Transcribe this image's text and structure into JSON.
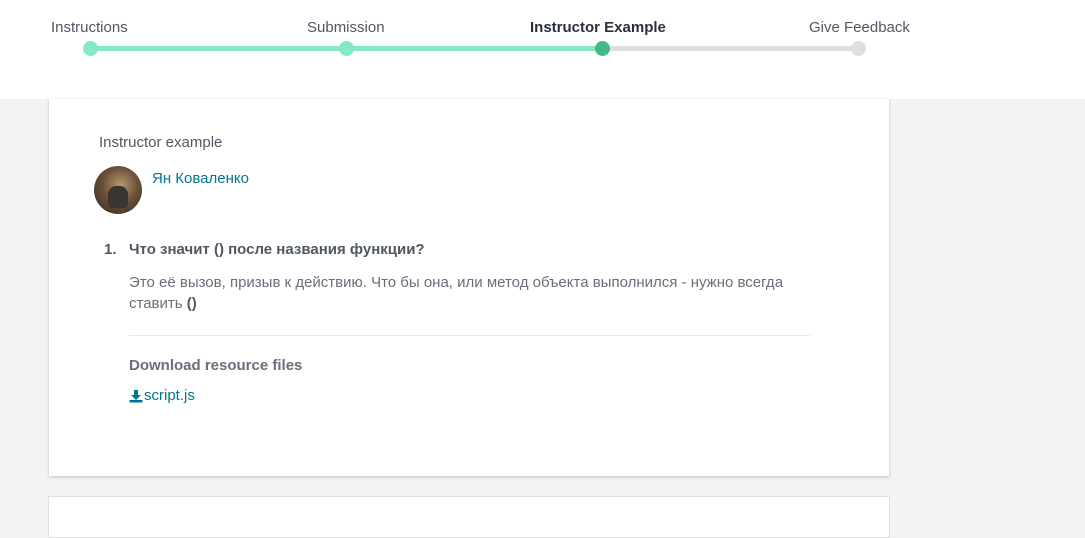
{
  "steps": [
    {
      "label": "Instructions",
      "state": "done"
    },
    {
      "label": "Submission",
      "state": "done"
    },
    {
      "label": "Instructor Example",
      "state": "current"
    },
    {
      "label": "Give Feedback",
      "state": "todo"
    }
  ],
  "colors": {
    "accent_done": "#84eac3",
    "accent_current": "#45b98a",
    "track_todo": "#dedfe0",
    "link": "#007791"
  },
  "example": {
    "title": "Instructor example",
    "author": "Ян Коваленко",
    "question_number": "1.",
    "question": "Что значит () после названия функции?",
    "answer_text": "Это её вызов, призыв к действию. Что бы она, или метод объекта выполнился - нужно всегда ставить",
    "answer_bold": "()",
    "resources_title": "Download resource files",
    "file_name": "script.js",
    "file_icon": "download-icon"
  }
}
